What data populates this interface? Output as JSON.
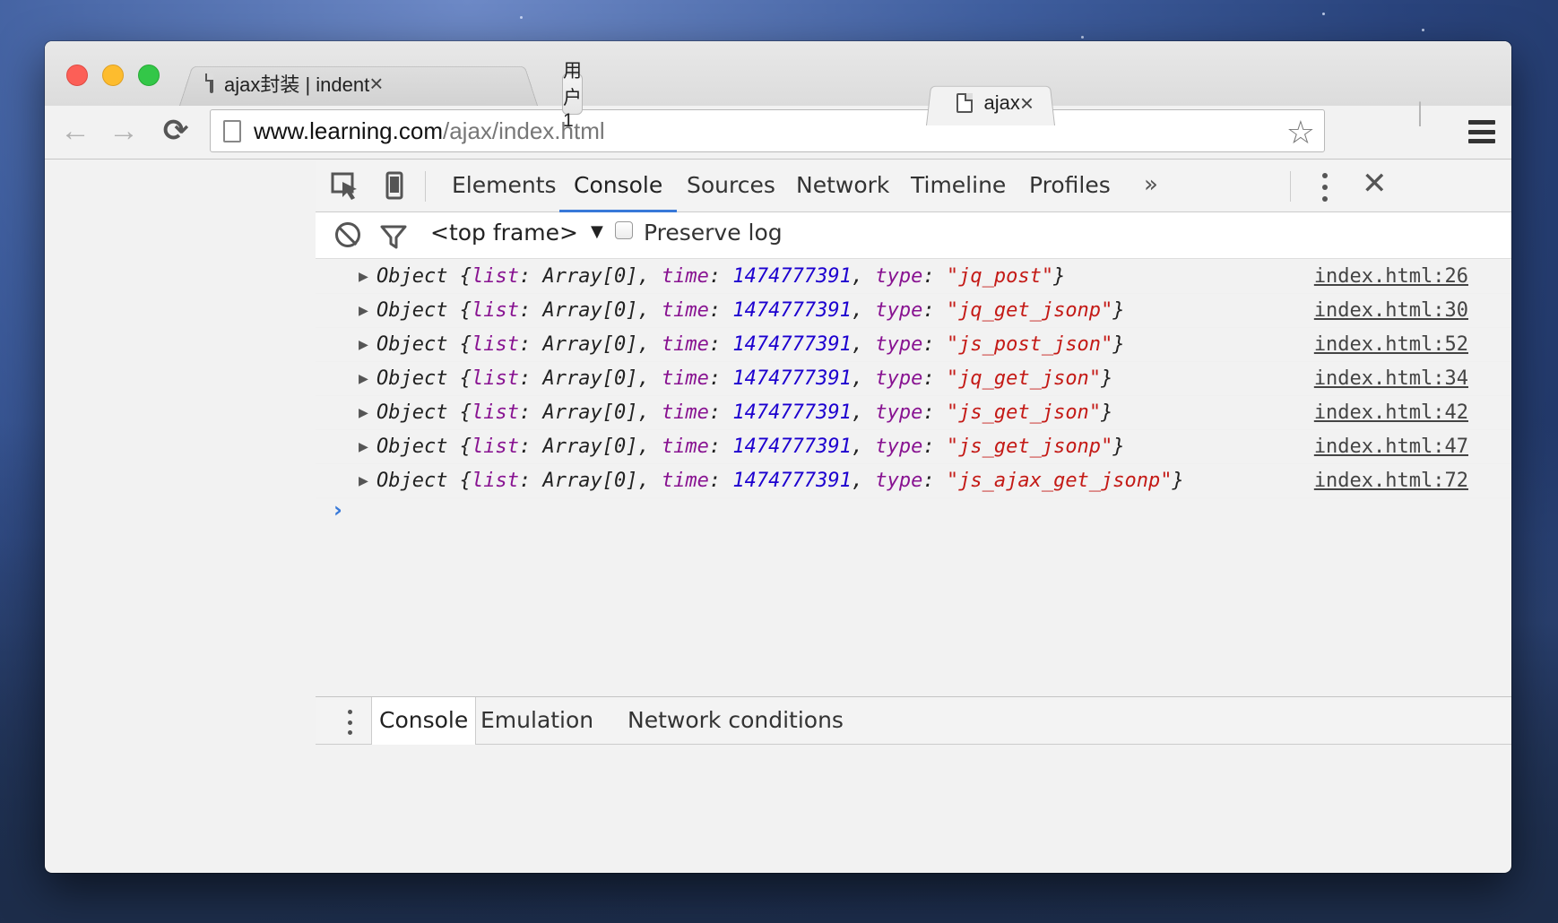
{
  "browser": {
    "tabs": [
      {
        "title": "ajax封装 | indent",
        "close": "×"
      },
      {
        "title": "ajax",
        "close": "×"
      }
    ],
    "user_label": "用户1",
    "url": {
      "host": "www.learning.com",
      "path": "/ajax/index.html"
    },
    "icons": {
      "back": "arrow-left-icon",
      "forward": "arrow-right-icon",
      "reload": "reload-icon",
      "star": "star-icon",
      "menu": "hamburger-icon"
    }
  },
  "devtools": {
    "tabs": [
      "Elements",
      "Console",
      "Sources",
      "Network",
      "Timeline",
      "Profiles"
    ],
    "active_tab": "Console",
    "more_label": "»",
    "close_label": "✕",
    "console_toolbar": {
      "frame": "<top frame>",
      "frame_arrow": "▼",
      "preserve_log": "Preserve log",
      "preserve_checked": false
    },
    "log": [
      {
        "type": "jq_post",
        "source": "index.html:26"
      },
      {
        "type": "jq_get_jsonp",
        "source": "index.html:30"
      },
      {
        "type": "js_post_json",
        "source": "index.html:52"
      },
      {
        "type": "jq_get_json",
        "source": "index.html:34"
      },
      {
        "type": "js_get_json",
        "source": "index.html:42"
      },
      {
        "type": "js_get_jsonp",
        "source": "index.html:47"
      },
      {
        "type": "js_ajax_get_jsonp",
        "source": "index.html:72"
      }
    ],
    "log_template": {
      "object": "Object",
      "list_key": "list",
      "list_val": "Array[0]",
      "time_key": "time",
      "time_val": "1474777391",
      "type_key": "type"
    },
    "prompt": "›",
    "drawer_tabs": [
      "Console",
      "Emulation",
      "Network conditions"
    ],
    "drawer_active": "Console",
    "colors": {
      "accent": "#3879d9",
      "key": "#881391",
      "number": "#1c00cf",
      "string": "#c41a16"
    }
  }
}
